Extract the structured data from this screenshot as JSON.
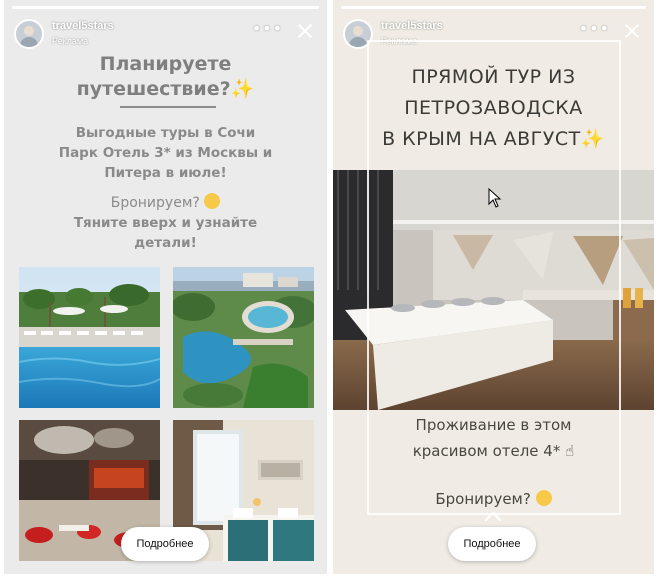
{
  "stories": [
    {
      "account": "travel5stars",
      "ad_label": "Реклама",
      "more_icon": "more-dots-icon",
      "close_icon": "close-icon",
      "title_lines": [
        "Планируете",
        "путешествие?"
      ],
      "body_lines": [
        "Выгодные туры в Сочи",
        "Парк Отель 3* из Москвы и",
        "Питера в июле!"
      ],
      "question": "Бронируем?",
      "cta_lines": [
        "Тяните вверх и узнайте",
        "детали!"
      ],
      "photos": [
        "pool-resort-photo",
        "aerial-resort-photo",
        "hotel-lobby-photo",
        "hotel-room-photo"
      ],
      "button_label": "Подробнее"
    },
    {
      "account": "travel5stars",
      "ad_label": "Реклама",
      "more_icon": "more-dots-icon",
      "close_icon": "close-icon",
      "title_lines": [
        "ПРЯМОЙ ТУР ИЗ",
        "ПЕТРОЗАВОДСКА",
        "В КРЫМ НА АВГУСТ"
      ],
      "photo": "hotel-restaurant-buffet-photo",
      "body_lines": [
        "Проживание в этом",
        "красивом отеле 4*"
      ],
      "question": "Бронируем?",
      "button_label": "Подробнее"
    }
  ],
  "colors": {
    "story1_bg": "#ebebeb",
    "story2_bg": "#f0ece5",
    "story1_text": "#8a8a8a",
    "story2_text": "#3c3a37"
  }
}
